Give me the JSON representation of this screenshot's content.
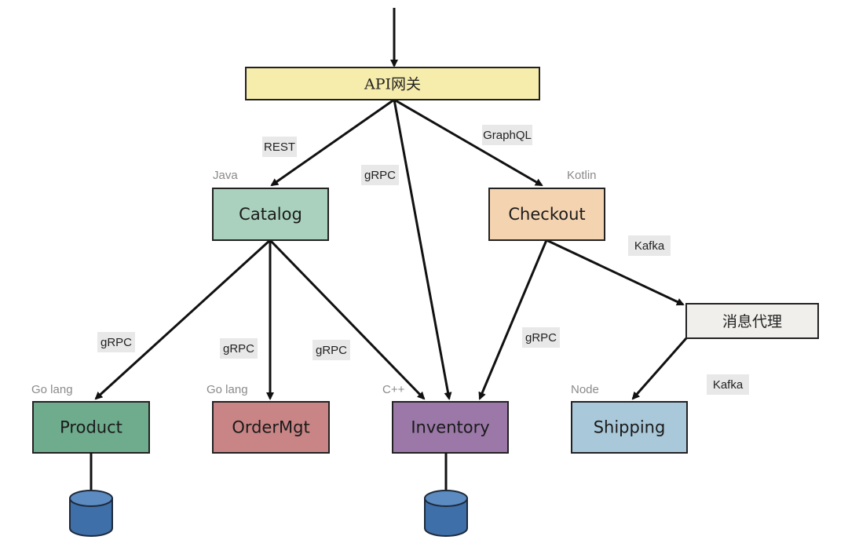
{
  "diagram": {
    "nodes": [
      {
        "id": "gateway",
        "label": "API网关",
        "lang": "",
        "color": "#f6ecac"
      },
      {
        "id": "catalog",
        "label": "Catalog",
        "lang": "Java",
        "color": "#a9d1bd"
      },
      {
        "id": "checkout",
        "label": "Checkout",
        "lang": "Kotlin",
        "color": "#f4d3b0"
      },
      {
        "id": "broker",
        "label": "消息代理",
        "lang": "",
        "color": "#f0efeb"
      },
      {
        "id": "product",
        "label": "Product",
        "lang": "Go lang",
        "color": "#6fab8d"
      },
      {
        "id": "ordermgt",
        "label": "OrderMgt",
        "lang": "Go lang",
        "color": "#c98585"
      },
      {
        "id": "inventory",
        "label": "Inventory",
        "lang": "C++",
        "color": "#9b78a8"
      },
      {
        "id": "shipping",
        "label": "Shipping",
        "lang": "Node",
        "color": "#a9c8d9"
      }
    ],
    "edges": [
      {
        "from": "entry",
        "to": "gateway",
        "protocol": ""
      },
      {
        "from": "gateway",
        "to": "catalog",
        "protocol": "REST"
      },
      {
        "from": "gateway",
        "to": "inventory",
        "protocol": "gRPC"
      },
      {
        "from": "gateway",
        "to": "checkout",
        "protocol": "GraphQL"
      },
      {
        "from": "checkout",
        "to": "broker",
        "protocol": "Kafka"
      },
      {
        "from": "catalog",
        "to": "product",
        "protocol": "gRPC"
      },
      {
        "from": "catalog",
        "to": "ordermgt",
        "protocol": "gRPC"
      },
      {
        "from": "catalog",
        "to": "inventory",
        "protocol": "gRPC"
      },
      {
        "from": "checkout",
        "to": "inventory",
        "protocol": "gRPC"
      },
      {
        "from": "broker",
        "to": "shipping",
        "protocol": "Kafka"
      }
    ],
    "databases": [
      {
        "id": "product-db",
        "attached_to": "product"
      },
      {
        "id": "inventory-db",
        "attached_to": "inventory"
      }
    ]
  }
}
